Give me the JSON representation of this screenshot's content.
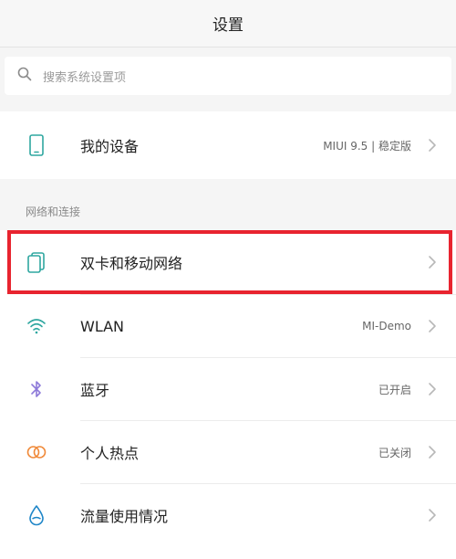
{
  "header": {
    "title": "设置"
  },
  "search": {
    "placeholder": "搜索系统设置项",
    "icon": "search-icon"
  },
  "device": {
    "label": "我的设备",
    "value": "MIUI 9.5 | 稳定版",
    "icon": "phone-icon"
  },
  "section": {
    "title": "网络和连接"
  },
  "items": [
    {
      "label": "双卡和移动网络",
      "value": "",
      "icon": "dual-sim-icon",
      "highlighted": true
    },
    {
      "label": "WLAN",
      "value": "MI-Demo",
      "icon": "wifi-icon"
    },
    {
      "label": "蓝牙",
      "value": "已开启",
      "icon": "bluetooth-icon"
    },
    {
      "label": "个人热点",
      "value": "已关闭",
      "icon": "hotspot-icon"
    },
    {
      "label": "流量使用情况",
      "value": "",
      "icon": "data-usage-icon"
    }
  ],
  "colors": {
    "highlight": "#e8242f",
    "icon_teal": "#2fa7a0",
    "bluetooth": "#8d7ad9",
    "hotspot": "#f08a3a",
    "data_usage": "#1f86c8"
  }
}
